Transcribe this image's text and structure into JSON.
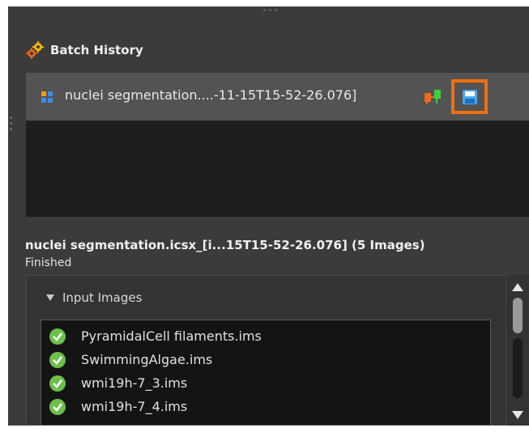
{
  "panel": {
    "title": "Batch History",
    "icon": "gears-icon"
  },
  "history": {
    "items": [
      {
        "name": "nuclei segmentation....-11-15T15-52-26.076]",
        "type_icon": "grid-icon",
        "status_icon": "network-icon",
        "action_icon": "save-icon",
        "selected": true
      }
    ]
  },
  "details": {
    "title": "nuclei segmentation.icsx_[i...15T15-52-26.076] (5 Images)",
    "status": "Finished",
    "section_label": "Input Images",
    "section_expanded": true,
    "images": [
      "PyramidalCell filaments.ims",
      "SwimmingAlgae.ims",
      "wmi19h-7_3.ims",
      "wmi19h-7_4.ims"
    ]
  },
  "colors": {
    "panel_bg": "#3b3b3b",
    "highlight": "#f26f0d",
    "check": "#6cc04a",
    "selected_row": "#535353"
  }
}
